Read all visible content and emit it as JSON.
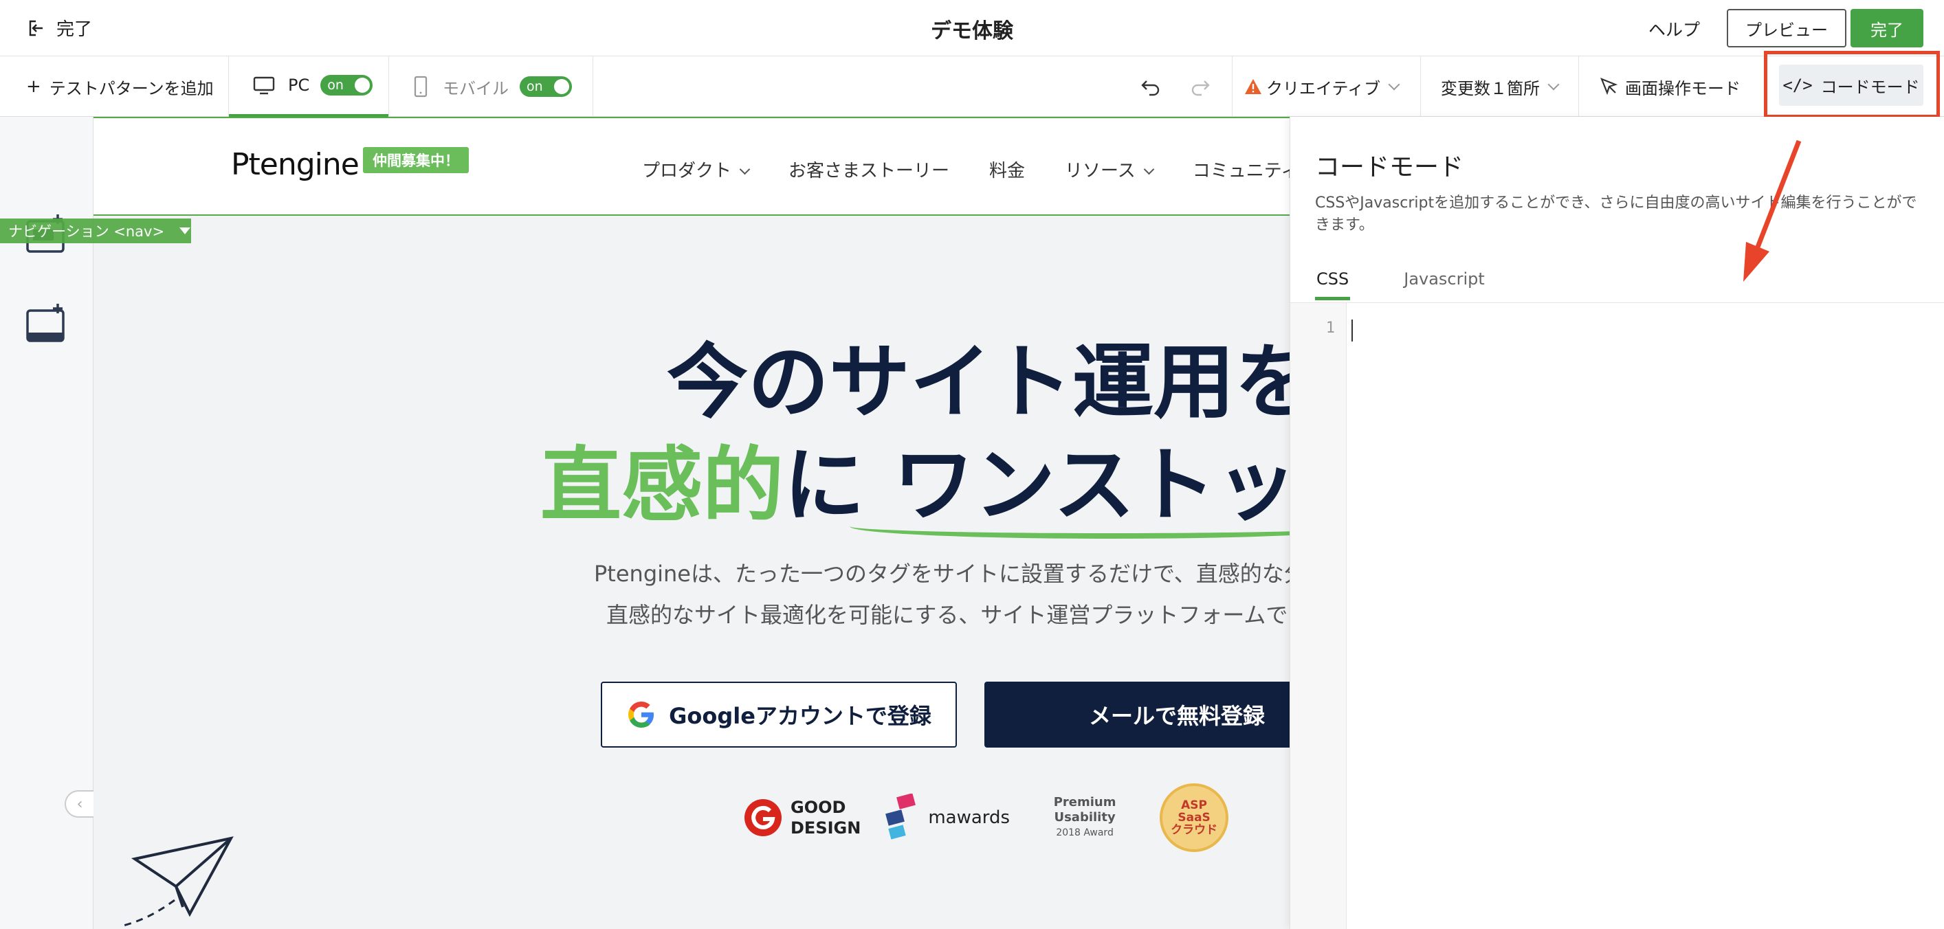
{
  "topbar": {
    "done_label": "完了",
    "title": "デモ体験",
    "help_label": "ヘルプ",
    "preview_label": "プレビュー",
    "done_button_label": "完了"
  },
  "toolbar": {
    "add_test_pattern_label": "テストパターンを追加",
    "pc_label": "PC",
    "pc_toggle": "on",
    "mobile_label": "モバイル",
    "mobile_toggle": "on",
    "creative_label": "クリエイティブ",
    "variables_label": "変更数１箇所",
    "screen_mode_label": "画面操作モード",
    "code_mode_label": "コードモード"
  },
  "left_panel": {
    "nav_tag_label": "ナビゲーション <nav>"
  },
  "site": {
    "logo": "Ptengine",
    "badge": "仲間募集中！",
    "menu": [
      "プロダクト",
      "お客さまストーリー",
      "料金",
      "リソース",
      "コミュニティ"
    ],
    "hero_line1": "今のサイト運用を",
    "hero_line2_green": "直感的",
    "hero_line2_rest": "に ワンストップ",
    "lead1": "Ptengineは、たった一つのタグをサイトに設置するだけで、直感的な分",
    "lead2": "直感的なサイト最適化を可能にする、サイト運営プラットフォームで",
    "google_button": "Googleアカウントで登録",
    "mail_button": "メールで無料登録",
    "awards": {
      "good_design_1": "GOOD",
      "good_design_2": "DESIGN",
      "mawards": "mawards",
      "premium_1": "Premium",
      "premium_2": "Usability",
      "premium_3": "2018 Award",
      "asp_1": "ASP",
      "asp_2": "SaaS",
      "asp_3": "クラウド"
    }
  },
  "code_panel": {
    "title": "コードモード",
    "description": "CSSやJavascriptを追加することができ、さらに自由度の高いサイト編集を行うことができます。",
    "tabs": [
      "CSS",
      "Javascript"
    ],
    "active_tab": "CSS",
    "line_number": "1"
  },
  "colors": {
    "brand_green": "#45a346",
    "navy": "#0f1f3d",
    "highlight_red": "#e8442a"
  }
}
